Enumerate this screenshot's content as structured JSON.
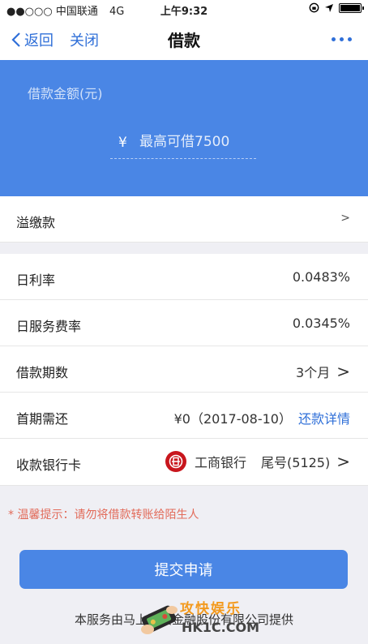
{
  "status_bar": {
    "carrier": "●●○○○ 中国联通",
    "network": "4G",
    "time": "上午9:32"
  },
  "nav": {
    "back_label": "返回",
    "close_label": "关闭",
    "title": "借款"
  },
  "amount": {
    "label": "借款金额(元)",
    "currency_symbol": "¥",
    "placeholder": "最高可借7500"
  },
  "rows": {
    "overpay": {
      "label": "溢缴款",
      "arrow": ">"
    },
    "daily_rate": {
      "label": "日利率",
      "value": "0.0483%"
    },
    "service_rate": {
      "label": "日服务费率",
      "value": "0.0345%"
    },
    "term": {
      "label": "借款期数",
      "value": "3个月",
      "arrow": ">"
    },
    "first_repay": {
      "label": "首期需还",
      "value": "¥0（2017-08-10）",
      "link": "还款详情"
    },
    "bank_card": {
      "label": "收款银行卡",
      "bank": "工商银行",
      "tail": "尾号(5125)",
      "arrow": ">"
    }
  },
  "tip": "* 温馨提示：请勿将借款转账给陌生人",
  "submit_label": "提交申请",
  "footer": "本服务由马上消费金融股份有限公司提供",
  "watermark": {
    "text": "攻快娱乐",
    "url": "HK1C.COM"
  },
  "colors": {
    "accent": "#4a86e5",
    "link": "#2f6fd8",
    "tip": "#e26b5a",
    "bank_logo": "#c8161d"
  }
}
